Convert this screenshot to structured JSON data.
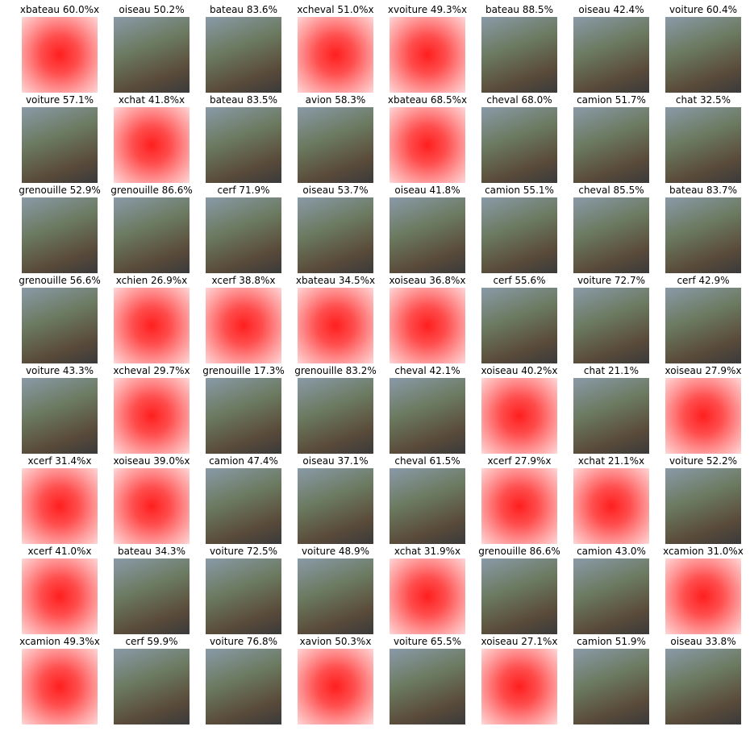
{
  "grid": {
    "rows": 8,
    "cols": 8,
    "cells": [
      {
        "label": "xbateau 60.0%x",
        "misclassified": true
      },
      {
        "label": "oiseau 50.2%",
        "misclassified": false
      },
      {
        "label": "bateau 83.6%",
        "misclassified": false
      },
      {
        "label": "xcheval 51.0%x",
        "misclassified": true
      },
      {
        "label": "xvoiture 49.3%x",
        "misclassified": true
      },
      {
        "label": "bateau 88.5%",
        "misclassified": false
      },
      {
        "label": "oiseau 42.4%",
        "misclassified": false
      },
      {
        "label": "voiture 60.4%",
        "misclassified": false
      },
      {
        "label": "voiture 57.1%",
        "misclassified": false
      },
      {
        "label": "xchat 41.8%x",
        "misclassified": true
      },
      {
        "label": "bateau 83.5%",
        "misclassified": false
      },
      {
        "label": "avion 58.3%",
        "misclassified": false
      },
      {
        "label": "xbateau 68.5%x",
        "misclassified": true
      },
      {
        "label": "cheval 68.0%",
        "misclassified": false
      },
      {
        "label": "camion 51.7%",
        "misclassified": false
      },
      {
        "label": "chat 32.5%",
        "misclassified": false
      },
      {
        "label": "grenouille 52.9%",
        "misclassified": false
      },
      {
        "label": "grenouille 86.6%",
        "misclassified": false
      },
      {
        "label": "cerf 71.9%",
        "misclassified": false
      },
      {
        "label": "oiseau 53.7%",
        "misclassified": false
      },
      {
        "label": "oiseau 41.8%",
        "misclassified": false
      },
      {
        "label": "camion 55.1%",
        "misclassified": false
      },
      {
        "label": "cheval 85.5%",
        "misclassified": false
      },
      {
        "label": "bateau 83.7%",
        "misclassified": false
      },
      {
        "label": "grenouille 56.6%",
        "misclassified": false
      },
      {
        "label": "xchien 26.9%x",
        "misclassified": true
      },
      {
        "label": "xcerf 38.8%x",
        "misclassified": true
      },
      {
        "label": "xbateau 34.5%x",
        "misclassified": true
      },
      {
        "label": "xoiseau 36.8%x",
        "misclassified": true
      },
      {
        "label": "cerf 55.6%",
        "misclassified": false
      },
      {
        "label": "voiture 72.7%",
        "misclassified": false
      },
      {
        "label": "cerf 42.9%",
        "misclassified": false
      },
      {
        "label": "voiture 43.3%",
        "misclassified": false
      },
      {
        "label": "xcheval 29.7%x",
        "misclassified": true
      },
      {
        "label": "grenouille 17.3%",
        "misclassified": false
      },
      {
        "label": "grenouille 83.2%",
        "misclassified": false
      },
      {
        "label": "cheval 42.1%",
        "misclassified": false
      },
      {
        "label": "xoiseau 40.2%x",
        "misclassified": true
      },
      {
        "label": "chat 21.1%",
        "misclassified": false
      },
      {
        "label": "xoiseau 27.9%x",
        "misclassified": true
      },
      {
        "label": "xcerf 31.4%x",
        "misclassified": true
      },
      {
        "label": "xoiseau 39.0%x",
        "misclassified": true
      },
      {
        "label": "camion 47.4%",
        "misclassified": false
      },
      {
        "label": "oiseau 37.1%",
        "misclassified": false
      },
      {
        "label": "cheval 61.5%",
        "misclassified": false
      },
      {
        "label": "xcerf 27.9%x",
        "misclassified": true
      },
      {
        "label": "xchat 21.1%x",
        "misclassified": true
      },
      {
        "label": "voiture 52.2%",
        "misclassified": false
      },
      {
        "label": "xcerf 41.0%x",
        "misclassified": true
      },
      {
        "label": "bateau 34.3%",
        "misclassified": false
      },
      {
        "label": "voiture 72.5%",
        "misclassified": false
      },
      {
        "label": "voiture 48.9%",
        "misclassified": false
      },
      {
        "label": "xchat 31.9%x",
        "misclassified": true
      },
      {
        "label": "grenouille 86.6%",
        "misclassified": false
      },
      {
        "label": "camion 43.0%",
        "misclassified": false
      },
      {
        "label": "xcamion 31.0%x",
        "misclassified": true
      },
      {
        "label": "xcamion 49.3%x",
        "misclassified": true
      },
      {
        "label": "cerf 59.9%",
        "misclassified": false
      },
      {
        "label": "voiture 76.8%",
        "misclassified": false
      },
      {
        "label": "xavion 50.3%x",
        "misclassified": true
      },
      {
        "label": "voiture 65.5%",
        "misclassified": false
      },
      {
        "label": "xoiseau 27.1%x",
        "misclassified": true
      },
      {
        "label": "camion 51.9%",
        "misclassified": false
      },
      {
        "label": "oiseau 33.8%",
        "misclassified": false
      }
    ]
  }
}
